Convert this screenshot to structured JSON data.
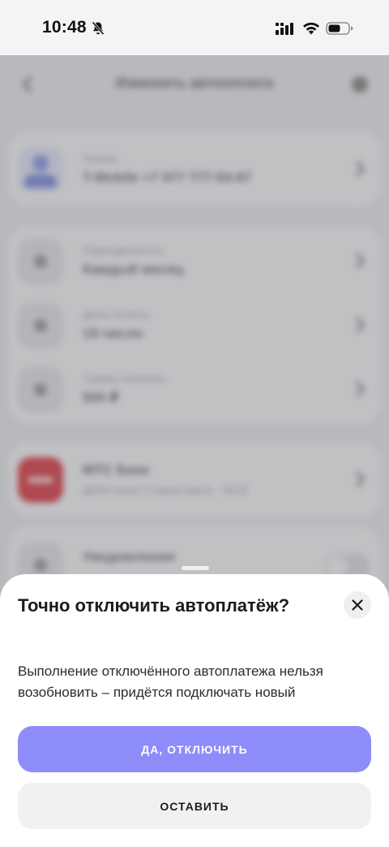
{
  "status_bar": {
    "time": "10:48",
    "icons": [
      "bell-slash-icon",
      "signal-icon",
      "wifi-icon",
      "battery-icon"
    ]
  },
  "background": {
    "header": {
      "title": "Изменить автооплата",
      "icons": [
        "chevron-left-icon",
        "gear-icon"
      ]
    },
    "number_card": {
      "label": "Номер",
      "value": "T-Mobile +7 977 777-54-87"
    },
    "schedule_card": {
      "rows": [
        {
          "label": "Периодичность",
          "value": "Каждый месяц"
        },
        {
          "label": "Дата оплаты",
          "value": "19 число"
        },
        {
          "label": "Сумма платежа",
          "value": "500 ₽"
        }
      ]
    },
    "bank_card": {
      "label": "МТС Банк",
      "value": "Дебетовая Старая карта · 5619"
    },
    "notifications_card": {
      "label": "Уведомления"
    }
  },
  "sheet": {
    "title": "Точно отключить автоплатёж?",
    "message": "Выполнение отключённого автоплатежа нельзя возобновить – придётся подключать новый",
    "confirm_label": "ДА, ОТКЛЮЧИТЬ",
    "keep_label": "ОСТАВИТЬ"
  },
  "colors": {
    "accent": "#8e8cf9",
    "secondary_button": "#f1f1f4",
    "sheet_background": "#ffffff",
    "bank_red": "#d8262f"
  }
}
